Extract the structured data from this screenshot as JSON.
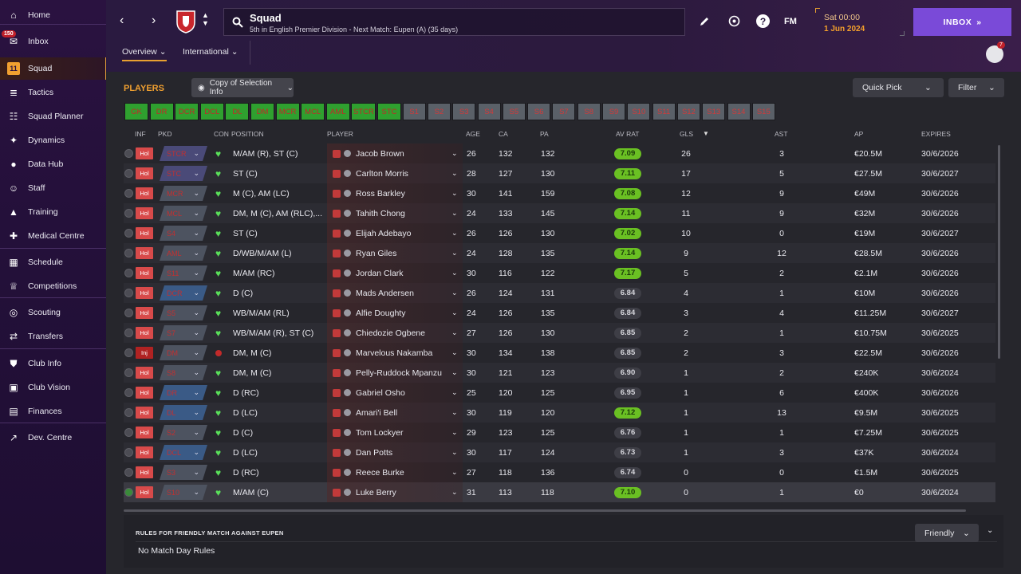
{
  "sidebar": {
    "inbox_badge": "150",
    "items": [
      {
        "label": "Home",
        "icon": "home-icon"
      },
      {
        "label": "Inbox",
        "icon": "inbox-icon"
      },
      {
        "label": "Squad",
        "icon": "squad-icon"
      },
      {
        "label": "Tactics",
        "icon": "tactics-icon"
      },
      {
        "label": "Squad Planner",
        "icon": "squad-planner-icon"
      },
      {
        "label": "Dynamics",
        "icon": "dynamics-icon"
      },
      {
        "label": "Data Hub",
        "icon": "data-hub-icon"
      },
      {
        "label": "Staff",
        "icon": "staff-icon"
      },
      {
        "label": "Training",
        "icon": "training-icon"
      },
      {
        "label": "Medical Centre",
        "icon": "medical-icon"
      },
      {
        "label": "Schedule",
        "icon": "schedule-icon"
      },
      {
        "label": "Competitions",
        "icon": "trophy-icon"
      },
      {
        "label": "Scouting",
        "icon": "scouting-icon"
      },
      {
        "label": "Transfers",
        "icon": "transfers-icon"
      },
      {
        "label": "Club Info",
        "icon": "club-info-icon"
      },
      {
        "label": "Club Vision",
        "icon": "club-vision-icon"
      },
      {
        "label": "Finances",
        "icon": "finances-icon"
      },
      {
        "label": "Dev. Centre",
        "icon": "dev-centre-icon"
      }
    ]
  },
  "header": {
    "title": "Squad",
    "subtitle": "5th in English Premier Division - Next Match: Eupen (A) (35 days)",
    "fm_label": "FM",
    "date_day": "Sat 00:00",
    "date_date": "1 Jun 2024",
    "inbox_label": "INBOX",
    "notif_count": "7",
    "tabs": [
      "Overview",
      "International"
    ]
  },
  "main": {
    "section_title": "PLAYERS",
    "copy_label": "Copy of Selection Info",
    "quick_pick_label": "Quick Pick",
    "filter_label": "Filter",
    "positions_green": [
      "GK",
      "DR",
      "DCR",
      "DCL",
      "DL",
      "DM",
      "MCR",
      "MCL",
      "AML",
      "STCR",
      "STC"
    ],
    "positions_grey": [
      "S1",
      "S2",
      "S3",
      "S4",
      "S5",
      "S6",
      "S7",
      "S8",
      "S9",
      "S10",
      "S11",
      "S12",
      "S13",
      "S14",
      "S15"
    ],
    "columns": {
      "inf": "INF",
      "pkd": "PKD",
      "con": "CON",
      "position": "POSITION",
      "player": "PLAYER",
      "age": "AGE",
      "ca": "CA",
      "pa": "PA",
      "avrat": "AV RAT",
      "gls": "GLS",
      "ast": "AST",
      "ap": "AP",
      "expires": "EXPIRES"
    },
    "players": [
      {
        "inf": "Hol",
        "pkd": "STCR",
        "pkd_color": "purple",
        "position": "M/AM (R), ST (C)",
        "name": "Jacob Brown",
        "age": "26",
        "ca": "132",
        "pa": "132",
        "rat": "7.09",
        "rat_good": true,
        "gls": "26",
        "ast": "3",
        "ap": "€20.5M",
        "expires": "30/6/2026"
      },
      {
        "inf": "Hol",
        "pkd": "STC",
        "pkd_color": "purple",
        "position": "ST (C)",
        "name": "Carlton Morris",
        "age": "28",
        "ca": "127",
        "pa": "130",
        "rat": "7.11",
        "rat_good": true,
        "gls": "17",
        "ast": "5",
        "ap": "€27.5M",
        "expires": "30/6/2027"
      },
      {
        "inf": "Hol",
        "pkd": "MCR",
        "pkd_color": "grey",
        "position": "M (C), AM (LC)",
        "name": "Ross Barkley",
        "age": "30",
        "ca": "141",
        "pa": "159",
        "rat": "7.08",
        "rat_good": true,
        "gls": "12",
        "ast": "9",
        "ap": "€49M",
        "expires": "30/6/2026"
      },
      {
        "inf": "Hol",
        "pkd": "MCL",
        "pkd_color": "grey",
        "position": "DM, M (C), AM (RLC),...",
        "name": "Tahith Chong",
        "age": "24",
        "ca": "133",
        "pa": "145",
        "rat": "7.14",
        "rat_good": true,
        "gls": "11",
        "ast": "9",
        "ap": "€32M",
        "expires": "30/6/2026"
      },
      {
        "inf": "Hol",
        "pkd": "S4",
        "pkd_color": "grey",
        "position": "ST (C)",
        "name": "Elijah Adebayo",
        "age": "26",
        "ca": "126",
        "pa": "130",
        "rat": "7.02",
        "rat_good": true,
        "gls": "10",
        "ast": "0",
        "ap": "€19M",
        "expires": "30/6/2027"
      },
      {
        "inf": "Hol",
        "pkd": "AML",
        "pkd_color": "grey",
        "position": "D/WB/M/AM (L)",
        "name": "Ryan Giles",
        "age": "24",
        "ca": "128",
        "pa": "135",
        "rat": "7.14",
        "rat_good": true,
        "gls": "9",
        "ast": "12",
        "ap": "€28.5M",
        "expires": "30/6/2026"
      },
      {
        "inf": "Hol",
        "pkd": "S11",
        "pkd_color": "grey",
        "position": "M/AM (RC)",
        "name": "Jordan Clark",
        "age": "30",
        "ca": "116",
        "pa": "122",
        "rat": "7.17",
        "rat_good": true,
        "gls": "5",
        "ast": "2",
        "ap": "€2.1M",
        "expires": "30/6/2026"
      },
      {
        "inf": "Hol",
        "pkd": "DCR",
        "pkd_color": "blue",
        "position": "D (C)",
        "name": "Mads Andersen",
        "age": "26",
        "ca": "124",
        "pa": "131",
        "rat": "6.84",
        "rat_good": false,
        "gls": "4",
        "ast": "1",
        "ap": "€10M",
        "expires": "30/6/2026"
      },
      {
        "inf": "Hol",
        "pkd": "S5",
        "pkd_color": "grey",
        "position": "WB/M/AM (RL)",
        "name": "Alfie Doughty",
        "age": "24",
        "ca": "126",
        "pa": "135",
        "rat": "6.84",
        "rat_good": false,
        "gls": "3",
        "ast": "4",
        "ap": "€11.25M",
        "expires": "30/6/2027"
      },
      {
        "inf": "Hol",
        "pkd": "S7",
        "pkd_color": "grey",
        "position": "WB/M/AM (R), ST (C)",
        "name": "Chiedozie Ogbene",
        "age": "27",
        "ca": "126",
        "pa": "130",
        "rat": "6.85",
        "rat_good": false,
        "gls": "2",
        "ast": "1",
        "ap": "€10.75M",
        "expires": "30/6/2025"
      },
      {
        "inf": "Inj",
        "pkd": "DM",
        "pkd_color": "grey",
        "position": "DM, M (C)",
        "name": "Marvelous Nakamba",
        "age": "30",
        "ca": "134",
        "pa": "138",
        "rat": "6.85",
        "rat_good": false,
        "gls": "2",
        "ast": "3",
        "ap": "€22.5M",
        "expires": "30/6/2026",
        "injured": true
      },
      {
        "inf": "Hol",
        "pkd": "S8",
        "pkd_color": "grey",
        "position": "DM, M (C)",
        "name": "Pelly-Ruddock Mpanzu",
        "age": "30",
        "ca": "121",
        "pa": "123",
        "rat": "6.90",
        "rat_good": false,
        "gls": "1",
        "ast": "2",
        "ap": "€240K",
        "expires": "30/6/2024"
      },
      {
        "inf": "Hol",
        "pkd": "DR",
        "pkd_color": "blue",
        "position": "D (RC)",
        "name": "Gabriel Osho",
        "age": "25",
        "ca": "120",
        "pa": "125",
        "rat": "6.95",
        "rat_good": false,
        "gls": "1",
        "ast": "6",
        "ap": "€400K",
        "expires": "30/6/2026"
      },
      {
        "inf": "Hol",
        "pkd": "DL",
        "pkd_color": "blue",
        "position": "D (LC)",
        "name": "Amari'i Bell",
        "age": "30",
        "ca": "119",
        "pa": "120",
        "rat": "7.12",
        "rat_good": true,
        "gls": "1",
        "ast": "13",
        "ap": "€9.5M",
        "expires": "30/6/2025"
      },
      {
        "inf": "Hol",
        "pkd": "S2",
        "pkd_color": "grey",
        "position": "D (C)",
        "name": "Tom Lockyer",
        "age": "29",
        "ca": "123",
        "pa": "125",
        "rat": "6.76",
        "rat_good": false,
        "gls": "1",
        "ast": "1",
        "ap": "€7.25M",
        "expires": "30/6/2025"
      },
      {
        "inf": "Hol",
        "pkd": "DCL",
        "pkd_color": "blue",
        "position": "D (LC)",
        "name": "Dan Potts",
        "age": "30",
        "ca": "117",
        "pa": "124",
        "rat": "6.73",
        "rat_good": false,
        "gls": "1",
        "ast": "3",
        "ap": "€37K",
        "expires": "30/6/2024"
      },
      {
        "inf": "Hol",
        "pkd": "S3",
        "pkd_color": "grey",
        "position": "D (RC)",
        "name": "Reece Burke",
        "age": "27",
        "ca": "118",
        "pa": "136",
        "rat": "6.74",
        "rat_good": false,
        "gls": "0",
        "ast": "0",
        "ap": "€1.5M",
        "expires": "30/6/2025"
      },
      {
        "inf": "Hol",
        "pkd": "S10",
        "pkd_color": "grey",
        "position": "M/AM (C)",
        "name": "Luke Berry",
        "age": "31",
        "ca": "113",
        "pa": "118",
        "rat": "7.10",
        "rat_good": true,
        "gls": "0",
        "ast": "1",
        "ap": "€0",
        "expires": "30/6/2024",
        "selected": true
      }
    ],
    "rules_title": "RULES FOR FRIENDLY MATCH AGAINST EUPEN",
    "rules_text": "No Match Day Rules",
    "friendly_label": "Friendly"
  }
}
